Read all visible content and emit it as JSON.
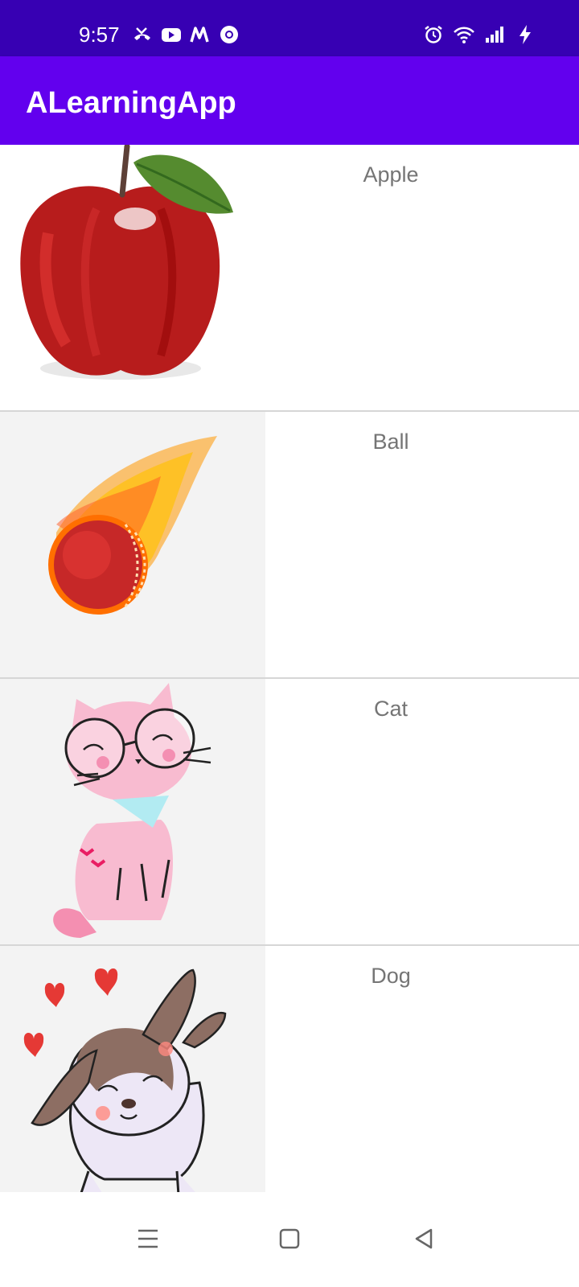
{
  "status_bar": {
    "time": "9:57",
    "left_icons": [
      "missed-call-icon",
      "youtube-icon",
      "m-app-icon",
      "chrome-icon"
    ],
    "right_icons": [
      "alarm-icon",
      "wifi-icon",
      "signal-icon",
      "charging-icon"
    ]
  },
  "app_bar": {
    "title": "ALearningApp"
  },
  "list": {
    "items": [
      {
        "label": "Apple",
        "image": "apple-image"
      },
      {
        "label": "Ball",
        "image": "fire-ball-image"
      },
      {
        "label": "Cat",
        "image": "cat-image"
      },
      {
        "label": "Dog",
        "image": "dog-image"
      }
    ]
  },
  "nav_bar": {
    "buttons": [
      "menu-icon",
      "home-icon",
      "back-icon"
    ]
  },
  "colors": {
    "status_bar": "#3700b3",
    "app_bar": "#6200ee",
    "label": "#757575",
    "divider": "#d6d6d6"
  }
}
